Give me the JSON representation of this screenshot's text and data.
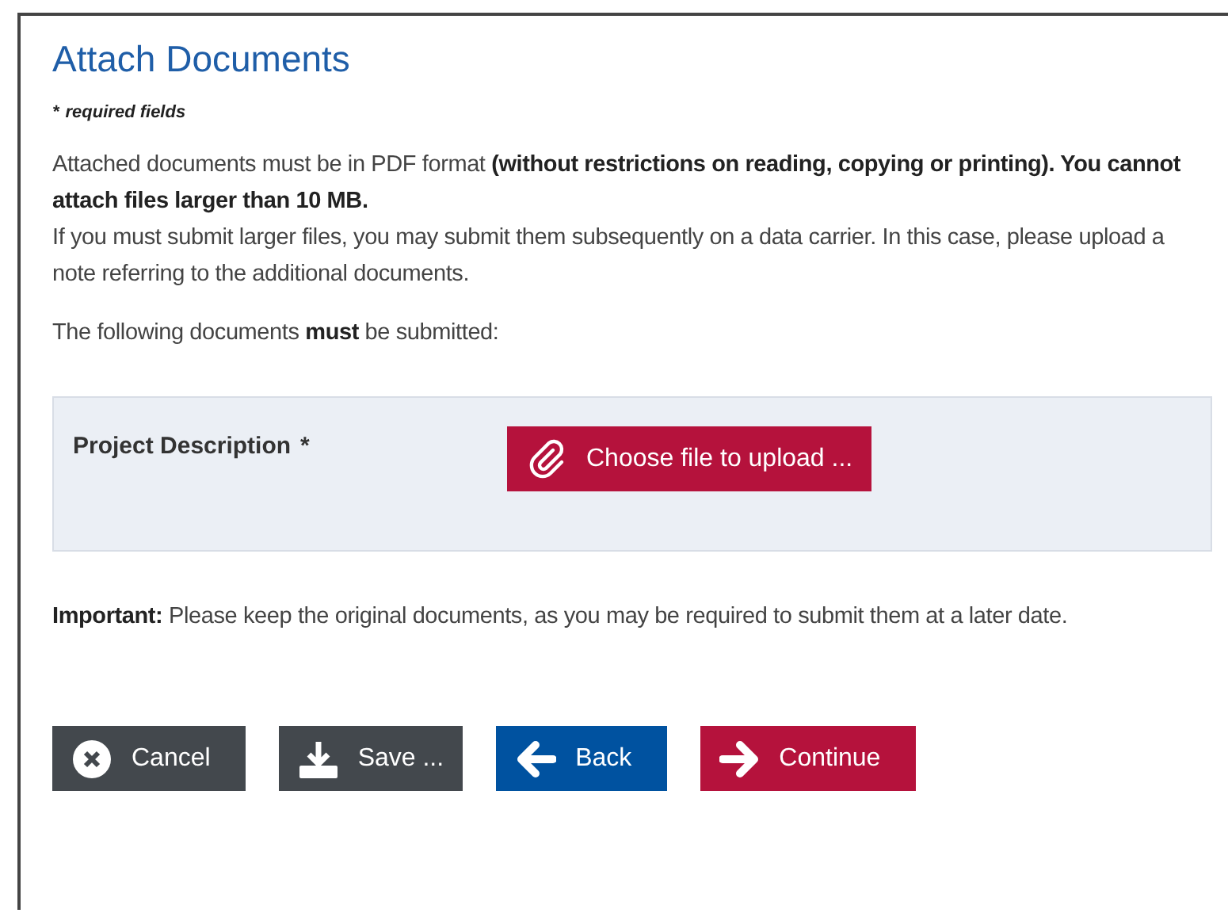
{
  "title": "Attach Documents",
  "required_note": {
    "mark": "*",
    "text": "required fields"
  },
  "intro": [
    "Attached documents must be in PDF format **(without restrictions on reading, copying or printing). You cannot attach files larger than 10 MB.**",
    "If you must submit larger files, you may submit them subsequently on a data carrier. In this case, please upload a note referring to the additional documents."
  ],
  "must_note": "The following documents **must** be submitted:",
  "documents": [
    {
      "label": "Project Description",
      "required_mark": "*",
      "button": "Choose file to upload ..."
    }
  ],
  "important": "**Important:** Please keep the original documents, as you may be required to submit them at a later date.",
  "buttons": [
    {
      "kind": "cancel",
      "label": "Cancel"
    },
    {
      "kind": "save",
      "label": "Save ..."
    },
    {
      "kind": "back",
      "label": "Back"
    },
    {
      "kind": "continue",
      "label": "Continue"
    }
  ]
}
